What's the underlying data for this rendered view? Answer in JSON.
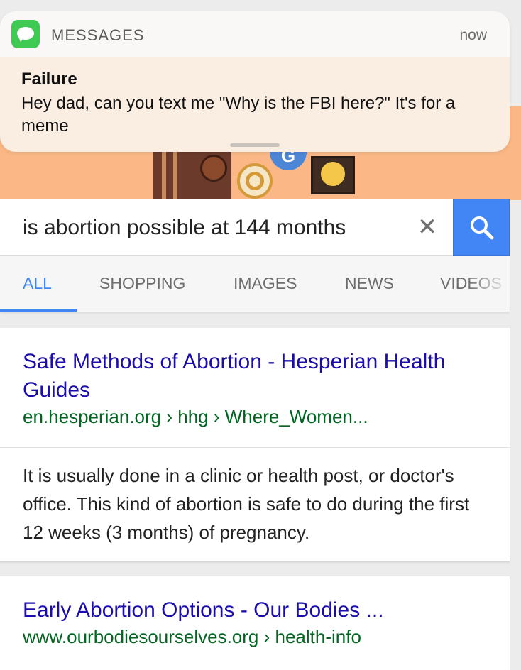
{
  "notification": {
    "app_name": "MESSAGES",
    "time": "now",
    "sender": "Failure",
    "message": "Hey dad, can you text me \"Why is the FBI here?\" It's for a meme",
    "app_icon": "messages-app-icon"
  },
  "doodle": {
    "letter": "G"
  },
  "search": {
    "query": "is abortion possible at 144 months",
    "clear_icon": "close-icon",
    "clear_glyph": "✕",
    "search_icon": "search-icon",
    "accent_color": "#4285f4"
  },
  "tabs": [
    {
      "label": "ALL",
      "active": true
    },
    {
      "label": "SHOPPING",
      "active": false
    },
    {
      "label": "IMAGES",
      "active": false
    },
    {
      "label": "NEWS",
      "active": false
    },
    {
      "label": "VIDEOS",
      "active": false
    }
  ],
  "results": [
    {
      "title": "Safe Methods of Abortion - Hesperian Health Guides",
      "url": "en.hesperian.org › hhg › Where_Women...",
      "snippet": "It is usually done in a clinic or health post, or doctor's office. This kind of abortion is safe to do during the first 12 weeks (3 months) of pregnancy."
    },
    {
      "title": "Early Abortion Options - Our Bodies ...",
      "url": "www.ourbodiesourselves.org › health-info"
    }
  ],
  "colors": {
    "link_title": "#1a0dab",
    "link_url": "#006621",
    "messages_green": "#3fcb53",
    "doodle_bg": "#fbb886"
  }
}
